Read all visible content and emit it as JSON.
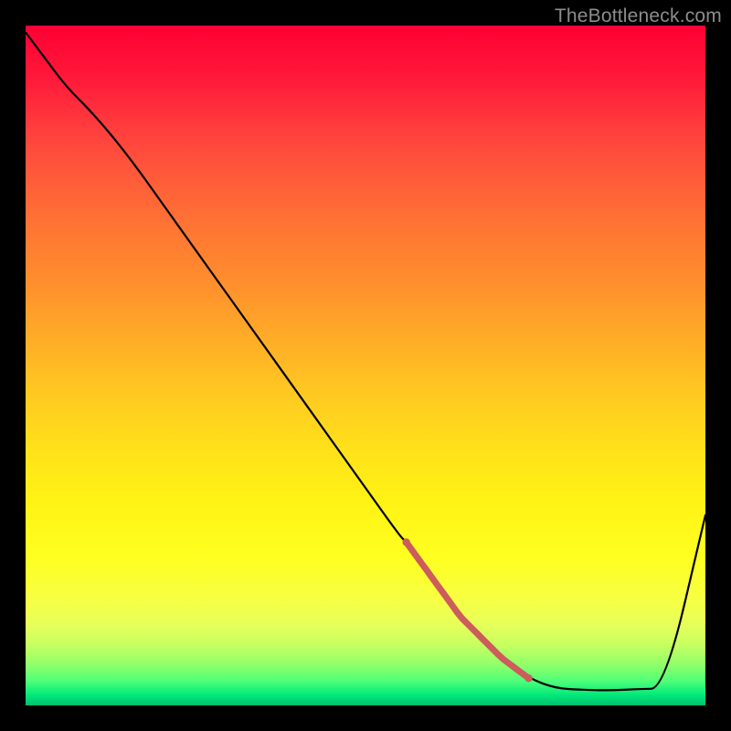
{
  "watermark_text": "TheBottleneck.com",
  "chart_data": {
    "type": "line",
    "title": "",
    "xlabel": "",
    "ylabel": "",
    "x": [
      0,
      3,
      6,
      10,
      15,
      20,
      25,
      30,
      35,
      40,
      45,
      50,
      55,
      56,
      60,
      64,
      65,
      68,
      70,
      74,
      78,
      82,
      86,
      90,
      94,
      100
    ],
    "values": [
      99,
      95,
      91,
      87,
      81,
      74,
      67,
      60,
      53,
      46,
      39,
      32,
      25,
      24,
      18.5,
      13,
      12,
      9,
      7,
      4,
      2.5,
      2.3,
      2.2,
      2.4,
      2.5,
      28
    ],
    "ylim": [
      0,
      100
    ],
    "xlim": [
      0,
      100
    ],
    "optimal_zone": {
      "from_x": 56,
      "to_x": 74
    }
  },
  "colors": {
    "curve": "#000000",
    "optimal_marker": "#cd5c5c",
    "frame": "#000000"
  }
}
